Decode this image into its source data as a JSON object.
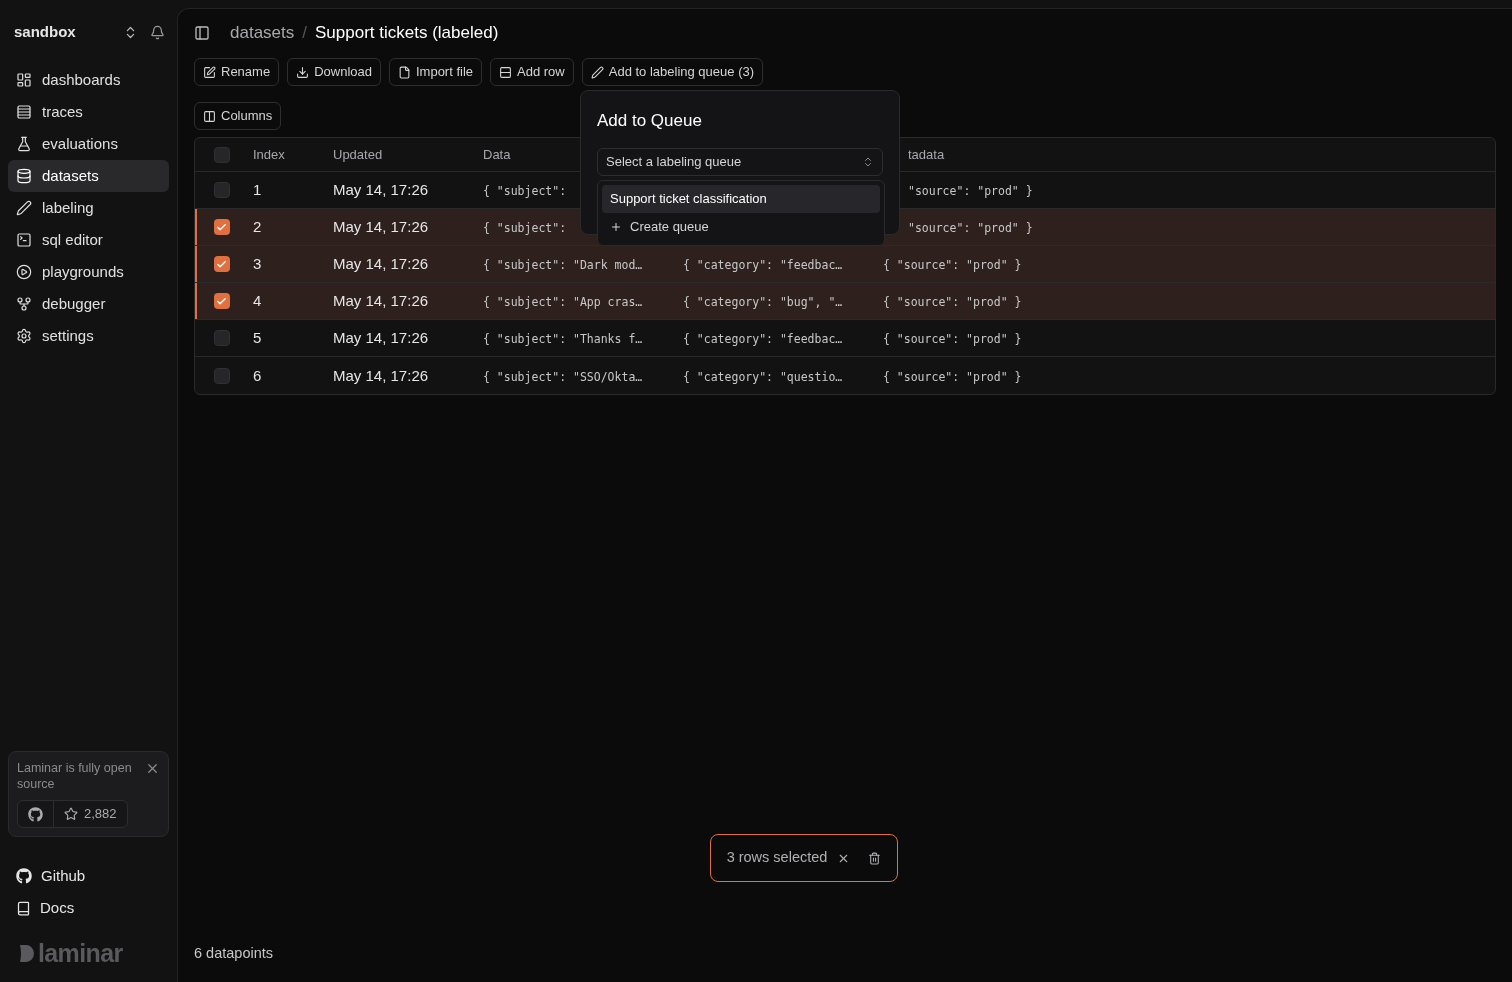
{
  "workspace": {
    "name": "sandbox"
  },
  "sidebar": {
    "items": [
      {
        "kind": "dashboards",
        "label": "dashboards",
        "selected": false
      },
      {
        "kind": "traces",
        "label": "traces",
        "selected": false
      },
      {
        "kind": "evaluations",
        "label": "evaluations",
        "selected": false
      },
      {
        "kind": "datasets",
        "label": "datasets",
        "selected": true
      },
      {
        "kind": "labeling",
        "label": "labeling",
        "selected": false
      },
      {
        "kind": "sql",
        "label": "sql editor",
        "selected": false
      },
      {
        "kind": "playgrounds",
        "label": "playgrounds",
        "selected": false
      },
      {
        "kind": "debugger",
        "label": "debugger",
        "selected": false
      },
      {
        "kind": "settings",
        "label": "settings",
        "selected": false
      }
    ],
    "promo": {
      "text": "Laminar is fully open source",
      "stars": "2,882"
    },
    "links": [
      {
        "kind": "github",
        "label": "Github"
      },
      {
        "kind": "docs",
        "label": "Docs"
      }
    ],
    "logo_text": "laminar"
  },
  "breadcrumb": {
    "parent": "datasets",
    "separator": "/",
    "current": "Support tickets (labeled)"
  },
  "toolbar": [
    {
      "kind": "rename",
      "label": "Rename"
    },
    {
      "kind": "download",
      "label": "Download"
    },
    {
      "kind": "import",
      "label": "Import file"
    },
    {
      "kind": "addrow",
      "label": "Add row"
    },
    {
      "kind": "queue",
      "label": "Add to labeling queue (3)"
    }
  ],
  "columns_button": "Columns",
  "table": {
    "header": {
      "checked": false,
      "index": "Index",
      "updated": "Updated",
      "data": "Data",
      "metadata": "tadata"
    },
    "rows": [
      {
        "selected": false,
        "index": "1",
        "updated": "May 14, 17:26",
        "data": "{ \"subject\":",
        "metadata": "\"source\": \"prod\" }"
      },
      {
        "selected": true,
        "index": "2",
        "updated": "May 14, 17:26",
        "data": "{ \"subject\":",
        "metadata": "\"source\": \"prod\" }"
      },
      {
        "selected": true,
        "index": "3",
        "updated": "May 14, 17:26",
        "data": "{ \"subject\": \"Dark mod…",
        "target": "{ \"category\": \"feedbac…",
        "metadata": "{ \"source\": \"prod\" }"
      },
      {
        "selected": true,
        "index": "4",
        "updated": "May 14, 17:26",
        "data": "{ \"subject\": \"App cras…",
        "target": "{ \"category\": \"bug\", \"…",
        "metadata": "{ \"source\": \"prod\" }"
      },
      {
        "selected": false,
        "index": "5",
        "updated": "May 14, 17:26",
        "data": "{ \"subject\": \"Thanks f…",
        "target": "{ \"category\": \"feedbac…",
        "metadata": "{ \"source\": \"prod\" }"
      },
      {
        "selected": false,
        "index": "6",
        "updated": "May 14, 17:26",
        "data": "{ \"subject\": \"SSO/Okta…",
        "target": "{ \"category\": \"questio…",
        "metadata": "{ \"source\": \"prod\" }"
      }
    ]
  },
  "popover": {
    "title": "Add to Queue",
    "select": {
      "placeholder": "Select a labeling queue"
    },
    "options": [
      {
        "kind": "queue",
        "label": "Support ticket classification",
        "highlighted": true
      },
      {
        "kind": "create",
        "label": "Create queue",
        "highlighted": false
      }
    ]
  },
  "selection_bar": {
    "text": "3 rows selected"
  },
  "footer": "6 datapoints"
}
